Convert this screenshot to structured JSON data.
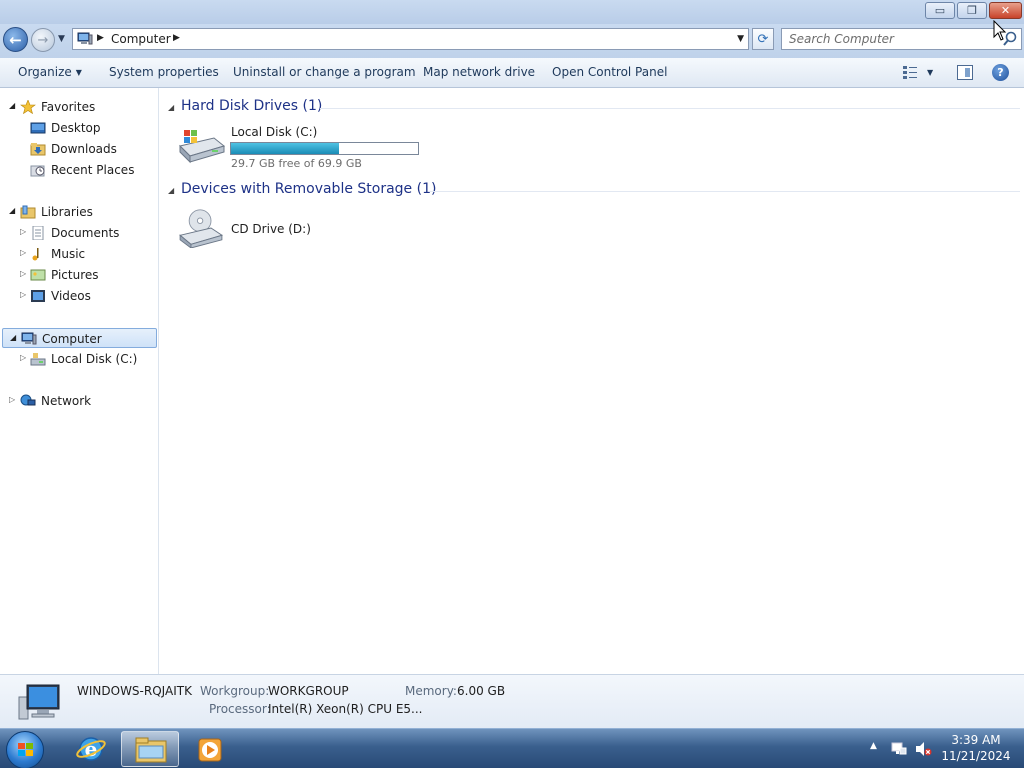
{
  "window": {
    "minimize_glyph": "▭",
    "restore_glyph": "❐",
    "close_glyph": "✕"
  },
  "address_bar": {
    "crumbs": [
      "Computer"
    ],
    "search_placeholder": "Search Computer"
  },
  "command_bar": {
    "items": [
      "Organize",
      "System properties",
      "Uninstall or change a program",
      "Map network drive",
      "Open Control Panel"
    ]
  },
  "nav_pane": {
    "favorites": {
      "label": "Favorites",
      "items": [
        "Desktop",
        "Downloads",
        "Recent Places"
      ]
    },
    "libraries": {
      "label": "Libraries",
      "items": [
        "Documents",
        "Music",
        "Pictures",
        "Videos"
      ]
    },
    "computer": {
      "label": "Computer",
      "items": [
        "Local Disk (C:)"
      ]
    },
    "network": {
      "label": "Network"
    }
  },
  "groups": {
    "hard_disks": {
      "title": "Hard Disk Drives (1)",
      "drives": [
        {
          "name": "Local Disk (C:)",
          "free_text": "29.7 GB free of 69.9 GB",
          "used_fraction": 0.575
        }
      ]
    },
    "removable": {
      "title": "Devices with Removable Storage (1)",
      "drives": [
        {
          "name": "CD Drive (D:)"
        }
      ]
    }
  },
  "details_pane": {
    "computer_name": "WINDOWS-RQJAITK",
    "workgroup_label": "Workgroup:",
    "workgroup_value": "WORKGROUP",
    "memory_label": "Memory:",
    "memory_value": "6.00 GB",
    "processor_label": "Processor:",
    "processor_value": "Intel(R) Xeon(R) CPU E5..."
  },
  "taskbar": {
    "time": "3:39 AM",
    "date": "11/21/2024",
    "pinned": [
      "internet-explorer",
      "windows-explorer",
      "media-player"
    ]
  },
  "colors": {
    "accent": "#1e3287",
    "selection": "#cfe2f8",
    "disk_fill": "#26a0c8"
  }
}
